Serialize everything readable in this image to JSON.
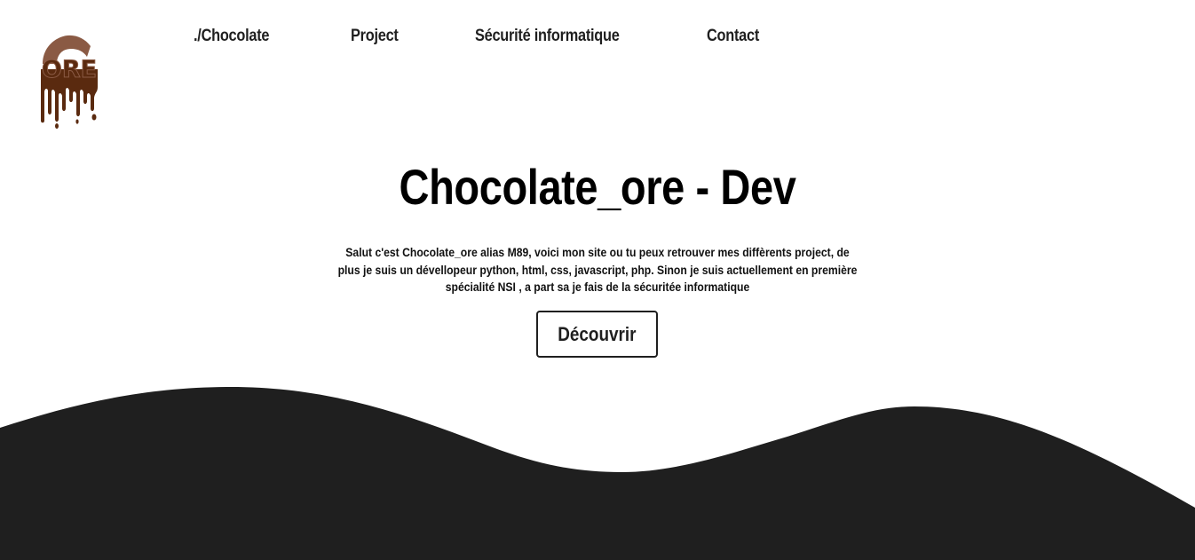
{
  "logo": {
    "text": "ORE",
    "colors": {
      "chocolate_dark": "#5a2a0f",
      "chocolate_light": "#8a5a44"
    }
  },
  "nav": {
    "items": [
      {
        "label": "./Chocolate"
      },
      {
        "label": "Project"
      },
      {
        "label": "Sécurité informatique"
      },
      {
        "label": "Contact"
      }
    ]
  },
  "hero": {
    "title": "Chocolate_ore - Dev",
    "description": "Salut c'est Chocolate_ore alias M89, voici mon site ou tu peux retrouver mes diffèrents project, de plus je suis un dévellopeur python, html, css, javascript, php. Sinon je suis actuellement en première spécialité NSI , a part sa je fais de la sécuritée informatique",
    "cta_label": "Découvrir"
  },
  "colors": {
    "background": "#ffffff",
    "wave": "#1f1f1f",
    "text": "#000000"
  }
}
